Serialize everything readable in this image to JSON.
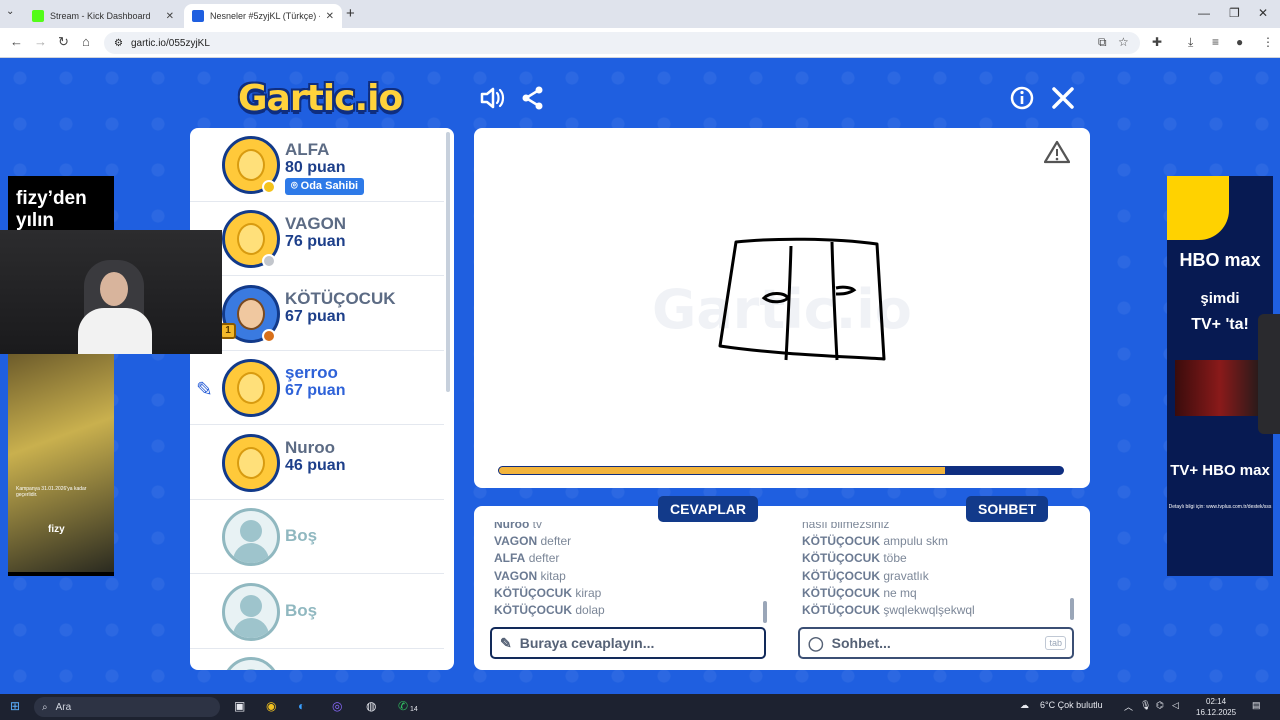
{
  "browser": {
    "tabs": [
      {
        "label": "Stream - Kick Dashboard",
        "favicon_color": "#53fc18"
      },
      {
        "label": "Nesneler #5zyjKL (Türkçe) - Gar",
        "favicon_color": "#1f5fe0"
      }
    ],
    "url": "gartic.io/055zyjKL"
  },
  "game": {
    "logo": "Gartic.io",
    "watermark": "Gartic.io",
    "progress_fraction": 0.79,
    "players": [
      {
        "name": "ALFA",
        "points": "80 puan",
        "badge": "Oda Sahibi",
        "dot": "#f4c21a",
        "state": "normal"
      },
      {
        "name": "VAGON",
        "points": "76 puan",
        "dot": "#c2c6cc",
        "state": "normal"
      },
      {
        "name": "KÖTÜÇOCUK",
        "points": "67 puan",
        "dot": "#d8701a",
        "state": "normal",
        "rank": "1"
      },
      {
        "name": "şerroo",
        "points": "67 puan",
        "state": "drawing"
      },
      {
        "name": "Nuroo",
        "points": "46 puan",
        "state": "normal"
      },
      {
        "name": "Boş",
        "state": "empty"
      },
      {
        "name": "Boş",
        "state": "empty"
      }
    ],
    "answers": {
      "title": "CEVAPLAR",
      "messages": [
        {
          "who": "Nuroo",
          "text": "tv"
        },
        {
          "who": "VAGON",
          "text": "defter"
        },
        {
          "who": "ALFA",
          "text": "defter"
        },
        {
          "who": "VAGON",
          "text": "kitap"
        },
        {
          "who": "KÖTÜÇOCUK",
          "text": "kirap"
        },
        {
          "who": "KÖTÜÇOCUK",
          "text": "dolap"
        }
      ],
      "placeholder": "Buraya cevaplayın..."
    },
    "chat": {
      "title": "SOHBET",
      "messages": [
        {
          "who": "",
          "text": "nasıl bilmezsiniz"
        },
        {
          "who": "KÖTÜÇOCUK",
          "text": "ampulu skm"
        },
        {
          "who": "KÖTÜÇOCUK",
          "text": "töbe"
        },
        {
          "who": "KÖTÜÇOCUK",
          "text": "gravatlık"
        },
        {
          "who": "KÖTÜÇOCUK",
          "text": "ne mq"
        },
        {
          "who": "KÖTÜÇOCUK",
          "text": "şwqlekwqlşekwql"
        }
      ],
      "placeholder": "Sohbet...",
      "hint": "tab"
    }
  },
  "ads": {
    "left_headline": "fizy’den yılın",
    "left_brand": "fizy",
    "left_small": "Kampanya 31.01.2026'ya kadar geçerlidir.",
    "right_lines": [
      "HBO max",
      "şimdi",
      "TV+ 'ta!",
      "TV+ HBO max"
    ],
    "right_small": "Detaylı bilgi için: www.tvplus.com.tr/destek/sss"
  },
  "taskbar": {
    "search": "Ara",
    "weather": "6°C  Çok bulutlu",
    "time": "02:14",
    "date": "16.12.2025",
    "whatsapp_badge": "14"
  }
}
